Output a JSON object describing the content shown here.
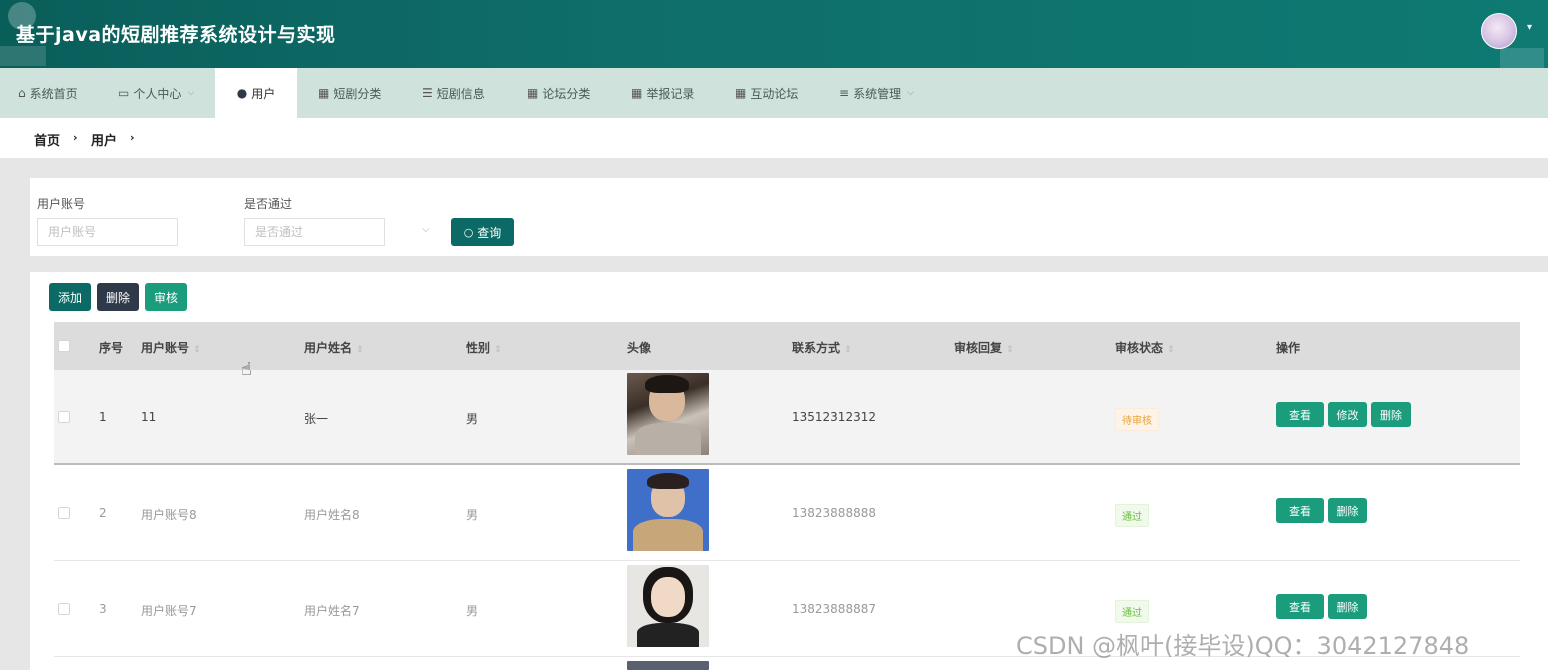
{
  "app": {
    "title": "基于java的短剧推荐系统设计与实现"
  },
  "nav": {
    "items": [
      {
        "label": "系统首页",
        "icon": "home-icon",
        "glyph": "⌂"
      },
      {
        "label": "个人中心",
        "icon": "profile-icon",
        "glyph": "▭",
        "chevron": "⌵"
      },
      {
        "label": "用户",
        "icon": "user-icon",
        "glyph": "●",
        "active": true
      },
      {
        "label": "短剧分类",
        "icon": "grid-icon",
        "glyph": "▦"
      },
      {
        "label": "短剧信息",
        "icon": "sliders-icon",
        "glyph": "☰"
      },
      {
        "label": "论坛分类",
        "icon": "grid-icon",
        "glyph": "▦"
      },
      {
        "label": "举报记录",
        "icon": "grid-icon",
        "glyph": "▦"
      },
      {
        "label": "互动论坛",
        "icon": "grid-icon",
        "glyph": "▦"
      },
      {
        "label": "系统管理",
        "icon": "menu-icon",
        "glyph": "≡",
        "chevron": "⌵"
      }
    ]
  },
  "breadcrumb": {
    "home": "首页",
    "current": "用户",
    "sep": "›"
  },
  "search": {
    "account_label": "用户账号",
    "account_placeholder": "用户账号",
    "passed_label": "是否通过",
    "passed_placeholder": "是否通过",
    "select_caret": "⌵",
    "query_button": "查询",
    "query_icon": "○"
  },
  "toolbar": {
    "add": "添加",
    "delete": "删除",
    "review": "审核"
  },
  "table": {
    "columns": [
      "序号",
      "用户账号",
      "用户姓名",
      "性别",
      "头像",
      "联系方式",
      "审核回复",
      "审核状态",
      "操作"
    ],
    "sort_glyph": "⇕",
    "rows": [
      {
        "index": "1",
        "account": "11",
        "name": "张一",
        "gender": "男",
        "phone": "13512312312",
        "reply": "",
        "status": "待审核",
        "status_kind": "pending",
        "actions": [
          "查看",
          "修改",
          "删除"
        ]
      },
      {
        "index": "2",
        "account": "用户账号8",
        "name": "用户姓名8",
        "gender": "男",
        "phone": "13823888888",
        "reply": "",
        "status": "通过",
        "status_kind": "passed",
        "actions": [
          "查看",
          "删除"
        ]
      },
      {
        "index": "3",
        "account": "用户账号7",
        "name": "用户姓名7",
        "gender": "男",
        "phone": "13823888887",
        "reply": "",
        "status": "通过",
        "status_kind": "passed",
        "actions": [
          "查看",
          "删除"
        ]
      }
    ]
  },
  "watermark": "CSDN @枫叶(接毕设)QQ：3042127848",
  "colors": {
    "brand": "#0f6e69",
    "nav_bg": "#cfe2dc",
    "action_green": "#1a9c7d",
    "add_button": "#0c6a66",
    "delete_button": "#2e3a4a",
    "review_button": "#1a9c7d",
    "pending_text": "#e6a23c",
    "passed_text": "#67c23a"
  }
}
